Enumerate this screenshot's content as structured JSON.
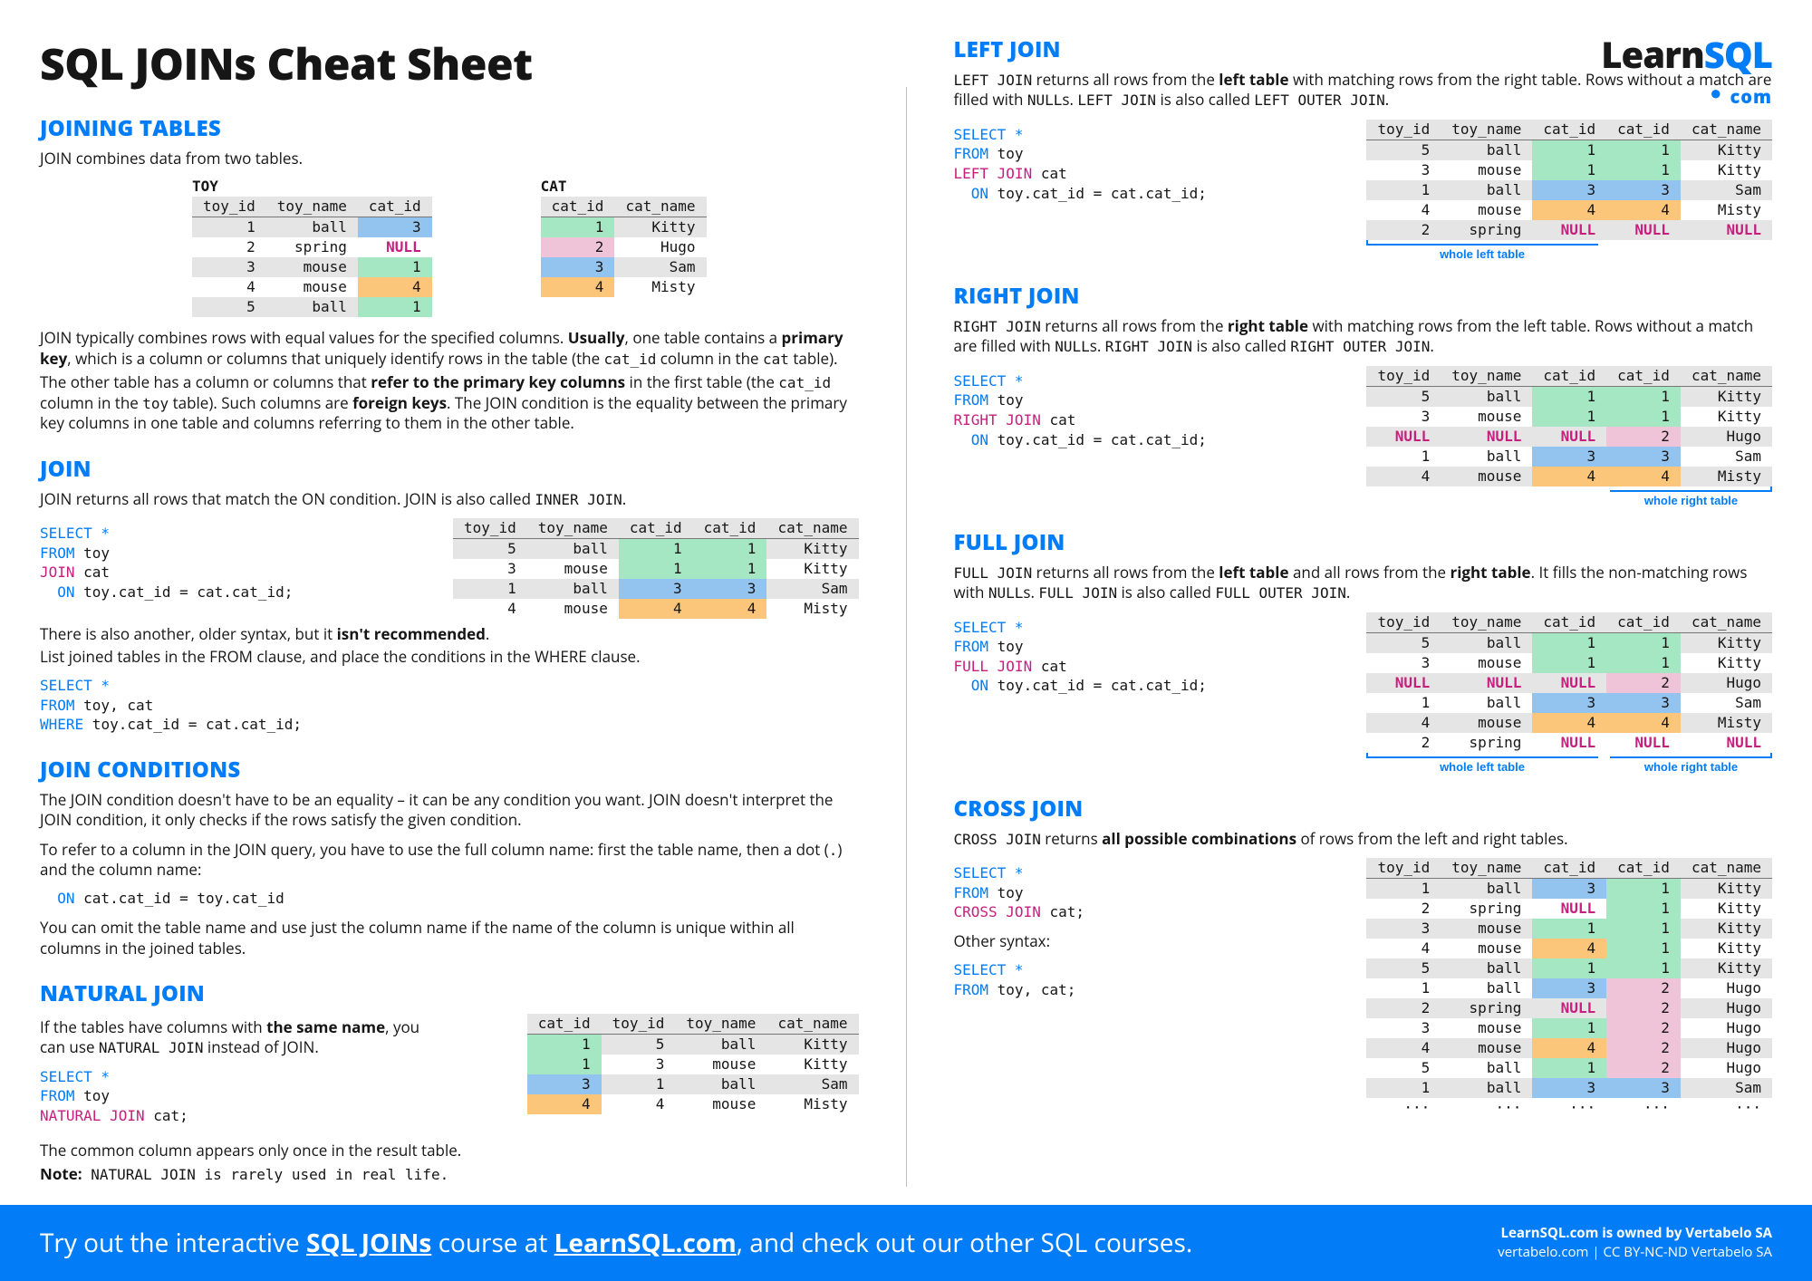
{
  "title": "SQL JOINs Cheat Sheet",
  "logo": {
    "brand_a": "Learn",
    "brand_b": "SQL",
    "sub": "com"
  },
  "toy_table": {
    "title": "TOY",
    "cols": [
      "toy_id",
      "toy_name",
      "cat_id"
    ],
    "rows": [
      [
        "1",
        "ball",
        "3"
      ],
      [
        "2",
        "spring",
        "NULL"
      ],
      [
        "3",
        "mouse",
        "1"
      ],
      [
        "4",
        "mouse",
        "4"
      ],
      [
        "5",
        "ball",
        "1"
      ]
    ]
  },
  "cat_table": {
    "title": "CAT",
    "cols": [
      "cat_id",
      "cat_name"
    ],
    "rows": [
      [
        "1",
        "Kitty"
      ],
      [
        "2",
        "Hugo"
      ],
      [
        "3",
        "Sam"
      ],
      [
        "4",
        "Misty"
      ]
    ]
  },
  "joining_tables": {
    "h": "JOINING TABLES",
    "intro": "JOIN combines data from two tables.",
    "para1_a": "JOIN typically combines rows with equal values for the specified columns. ",
    "para1_b": "Usually",
    "para1_c": ", one table contains a ",
    "para1_d": "primary key",
    "para1_e": ", which is a column or columns that uniquely identify rows in the table (the ",
    "para1_f": "cat_id",
    "para1_g": " column in the ",
    "para1_h": "cat",
    "para1_i": " table).",
    "para2_a": "The other table has a column or columns that ",
    "para2_b": "refer to the primary key columns",
    "para2_c": " in the first table (the ",
    "para2_d": "cat_id",
    "para2_e": " column in the ",
    "para2_f": "toy",
    "para2_g": " table). Such columns are ",
    "para2_h": "foreign keys",
    "para2_i": ". The JOIN condition is the equality between the primary key columns in one table and columns referring to them in the other table."
  },
  "join": {
    "h": "JOIN",
    "desc_a": "JOIN returns all rows that match the ON condition. JOIN is also called ",
    "desc_b": "INNER JOIN",
    "desc_c": ".",
    "code": [
      {
        "t": "SELECT *",
        "c": "kw-blue"
      },
      {
        "t": "FROM",
        "c": "kw-blue"
      },
      {
        "t": " toy"
      },
      {
        "t": "JOIN",
        "c": "kw-mag"
      },
      {
        "t": " cat"
      },
      {
        "t": "  ON",
        "c": "kw-blue"
      },
      {
        "t": " toy.cat_id = cat.cat_id;"
      }
    ],
    "result_cols": [
      "toy_id",
      "toy_name",
      "cat_id",
      "cat_id",
      "cat_name"
    ],
    "result": [
      [
        "5",
        "ball",
        "1",
        "1",
        "Kitty"
      ],
      [
        "3",
        "mouse",
        "1",
        "1",
        "Kitty"
      ],
      [
        "1",
        "ball",
        "3",
        "3",
        "Sam"
      ],
      [
        "4",
        "mouse",
        "4",
        "4",
        "Misty"
      ]
    ],
    "after_a": "There is also another, older syntax, but it ",
    "after_b": "isn't recommended",
    "after_c": ".",
    "after_d": "List joined tables in the FROM clause, and place the conditions in the WHERE clause.",
    "code2": [
      {
        "t": "SELECT *",
        "c": "kw-blue"
      },
      {
        "t": "FROM",
        "c": "kw-blue"
      },
      {
        "t": " toy, cat"
      },
      {
        "t": "WHERE",
        "c": "kw-blue"
      },
      {
        "t": " toy.cat_id = cat.cat_id;"
      }
    ]
  },
  "join_cond": {
    "h": "JOIN CONDITIONS",
    "p1": "The JOIN condition doesn't have to be an equality – it can be any condition you want. JOIN doesn't interpret the JOIN condition, it only checks if the rows satisfy the given condition.",
    "p2_a": "To refer to a column in the JOIN query, you have to use the full column name: first the table name, then a dot (",
    "p2_b": ".",
    "p2_c": ") and the column name:",
    "code": "  ON cat.cat_id = toy.cat_id",
    "p3": "You can omit the table name and use just the column name if the name of the column is unique within all columns in the joined tables."
  },
  "natural": {
    "h": "NATURAL JOIN",
    "p1_a": "If the tables have columns with ",
    "p1_b": "the same name",
    "p1_c": ", you can use ",
    "p1_d": "NATURAL JOIN",
    "p1_e": " instead of JOIN.",
    "code": [
      {
        "t": "SELECT *",
        "c": "kw-blue"
      },
      {
        "t": "FROM",
        "c": "kw-blue"
      },
      {
        "t": " toy"
      },
      {
        "t": "NATURAL JOIN",
        "c": "kw-mag"
      },
      {
        "t": " cat;"
      }
    ],
    "result_cols": [
      "cat_id",
      "toy_id",
      "toy_name",
      "cat_name"
    ],
    "result": [
      [
        "1",
        "5",
        "ball",
        "Kitty"
      ],
      [
        "1",
        "3",
        "mouse",
        "Kitty"
      ],
      [
        "3",
        "1",
        "ball",
        "Sam"
      ],
      [
        "4",
        "4",
        "mouse",
        "Misty"
      ]
    ],
    "p2": "The common column appears only once in the result table.",
    "p3_a": "Note:",
    "p3_b": " NATURAL JOIN is rarely used in real life."
  },
  "left": {
    "h": "LEFT JOIN",
    "desc_a": "LEFT JOIN",
    "desc_b": " returns all rows from the ",
    "desc_c": "left table",
    "desc_d": " with matching rows from the right table. Rows without a match are filled with ",
    "desc_e": "NULL",
    "desc_f": "s. ",
    "desc_g": "LEFT JOIN",
    "desc_h": " is also called ",
    "desc_i": "LEFT OUTER JOIN",
    "desc_j": ".",
    "code": [
      {
        "t": "SELECT *",
        "c": "kw-blue"
      },
      {
        "t": "FROM",
        "c": "kw-blue"
      },
      {
        "t": " toy"
      },
      {
        "t": "LEFT JOIN",
        "c": "kw-mag"
      },
      {
        "t": " cat"
      },
      {
        "t": "  ON",
        "c": "kw-blue"
      },
      {
        "t": " toy.cat_id = cat.cat_id;"
      }
    ],
    "result_cols": [
      "toy_id",
      "toy_name",
      "cat_id",
      "cat_id",
      "cat_name"
    ],
    "result": [
      [
        "5",
        "ball",
        "1",
        "1",
        "Kitty"
      ],
      [
        "3",
        "mouse",
        "1",
        "1",
        "Kitty"
      ],
      [
        "1",
        "ball",
        "3",
        "3",
        "Sam"
      ],
      [
        "4",
        "mouse",
        "4",
        "4",
        "Misty"
      ],
      [
        "2",
        "spring",
        "NULL",
        "NULL",
        "NULL"
      ]
    ],
    "annot": "whole left table"
  },
  "right": {
    "h": "RIGHT JOIN",
    "desc_a": "RIGHT JOIN",
    "desc_b": " returns all rows from the ",
    "desc_c": "right table",
    "desc_d": " with matching rows from the left table. Rows without a match are filled with ",
    "desc_e": "NULL",
    "desc_f": "s. ",
    "desc_g": "RIGHT JOIN",
    "desc_h": " is also called ",
    "desc_i": "RIGHT OUTER JOIN",
    "desc_j": ".",
    "code": [
      {
        "t": "SELECT *",
        "c": "kw-blue"
      },
      {
        "t": "FROM",
        "c": "kw-blue"
      },
      {
        "t": " toy"
      },
      {
        "t": "RIGHT JOIN",
        "c": "kw-mag"
      },
      {
        "t": " cat"
      },
      {
        "t": "  ON",
        "c": "kw-blue"
      },
      {
        "t": " toy.cat_id = cat.cat_id;"
      }
    ],
    "result_cols": [
      "toy_id",
      "toy_name",
      "cat_id",
      "cat_id",
      "cat_name"
    ],
    "result": [
      [
        "5",
        "ball",
        "1",
        "1",
        "Kitty"
      ],
      [
        "3",
        "mouse",
        "1",
        "1",
        "Kitty"
      ],
      [
        "NULL",
        "NULL",
        "NULL",
        "2",
        "Hugo"
      ],
      [
        "1",
        "ball",
        "3",
        "3",
        "Sam"
      ],
      [
        "4",
        "mouse",
        "4",
        "4",
        "Misty"
      ]
    ],
    "annot": "whole right table"
  },
  "full": {
    "h": "FULL JOIN",
    "desc_a": "FULL JOIN",
    "desc_b": " returns all rows from the ",
    "desc_c": "left table",
    "desc_d": " and all rows from the ",
    "desc_e": "right table",
    "desc_f": ". It fills the non-matching rows with ",
    "desc_g": "NULL",
    "desc_h": "s. ",
    "desc_i": "FULL JOIN",
    "desc_j": " is also called ",
    "desc_k": "FULL OUTER JOIN",
    "desc_l": ".",
    "code": [
      {
        "t": "SELECT *",
        "c": "kw-blue"
      },
      {
        "t": "FROM",
        "c": "kw-blue"
      },
      {
        "t": " toy"
      },
      {
        "t": "FULL JOIN",
        "c": "kw-mag"
      },
      {
        "t": " cat"
      },
      {
        "t": "  ON",
        "c": "kw-blue"
      },
      {
        "t": " toy.cat_id = cat.cat_id;"
      }
    ],
    "result_cols": [
      "toy_id",
      "toy_name",
      "cat_id",
      "cat_id",
      "cat_name"
    ],
    "result": [
      [
        "5",
        "ball",
        "1",
        "1",
        "Kitty"
      ],
      [
        "3",
        "mouse",
        "1",
        "1",
        "Kitty"
      ],
      [
        "NULL",
        "NULL",
        "NULL",
        "2",
        "Hugo"
      ],
      [
        "1",
        "ball",
        "3",
        "3",
        "Sam"
      ],
      [
        "4",
        "mouse",
        "4",
        "4",
        "Misty"
      ],
      [
        "2",
        "spring",
        "NULL",
        "NULL",
        "NULL"
      ]
    ],
    "annot_l": "whole left table",
    "annot_r": "whole right table"
  },
  "cross": {
    "h": "CROSS JOIN",
    "desc_a": "CROSS JOIN",
    "desc_b": " returns ",
    "desc_c": "all possible combinations",
    "desc_d": " of rows from the left and right tables.",
    "code": [
      {
        "t": "SELECT *",
        "c": "kw-blue"
      },
      {
        "t": "FROM",
        "c": "kw-blue"
      },
      {
        "t": " toy"
      },
      {
        "t": "CROSS JOIN",
        "c": "kw-mag"
      },
      {
        "t": " cat;"
      }
    ],
    "other": "Other syntax:",
    "code2": [
      {
        "t": "SELECT *",
        "c": "kw-blue"
      },
      {
        "t": "FROM",
        "c": "kw-blue"
      },
      {
        "t": " toy, cat;"
      }
    ],
    "result_cols": [
      "toy_id",
      "toy_name",
      "cat_id",
      "cat_id",
      "cat_name"
    ],
    "result": [
      [
        "1",
        "ball",
        "3",
        "1",
        "Kitty"
      ],
      [
        "2",
        "spring",
        "NULL",
        "1",
        "Kitty"
      ],
      [
        "3",
        "mouse",
        "1",
        "1",
        "Kitty"
      ],
      [
        "4",
        "mouse",
        "4",
        "1",
        "Kitty"
      ],
      [
        "5",
        "ball",
        "1",
        "1",
        "Kitty"
      ],
      [
        "1",
        "ball",
        "3",
        "2",
        "Hugo"
      ],
      [
        "2",
        "spring",
        "NULL",
        "2",
        "Hugo"
      ],
      [
        "3",
        "mouse",
        "1",
        "2",
        "Hugo"
      ],
      [
        "4",
        "mouse",
        "4",
        "2",
        "Hugo"
      ],
      [
        "5",
        "ball",
        "1",
        "2",
        "Hugo"
      ],
      [
        "1",
        "ball",
        "3",
        "3",
        "Sam"
      ],
      [
        "···",
        "···",
        "···",
        "···",
        "···"
      ]
    ]
  },
  "footer": {
    "left_a": "Try out the interactive ",
    "left_b": "SQL JOINs",
    "left_c": " course at ",
    "left_d": "LearnSQL.com",
    "left_e": ", and check out our other SQL courses.",
    "right_a": "LearnSQL.com is owned by Vertabelo SA",
    "right_b": "vertabelo.com | CC BY-NC-ND Vertabelo SA"
  }
}
